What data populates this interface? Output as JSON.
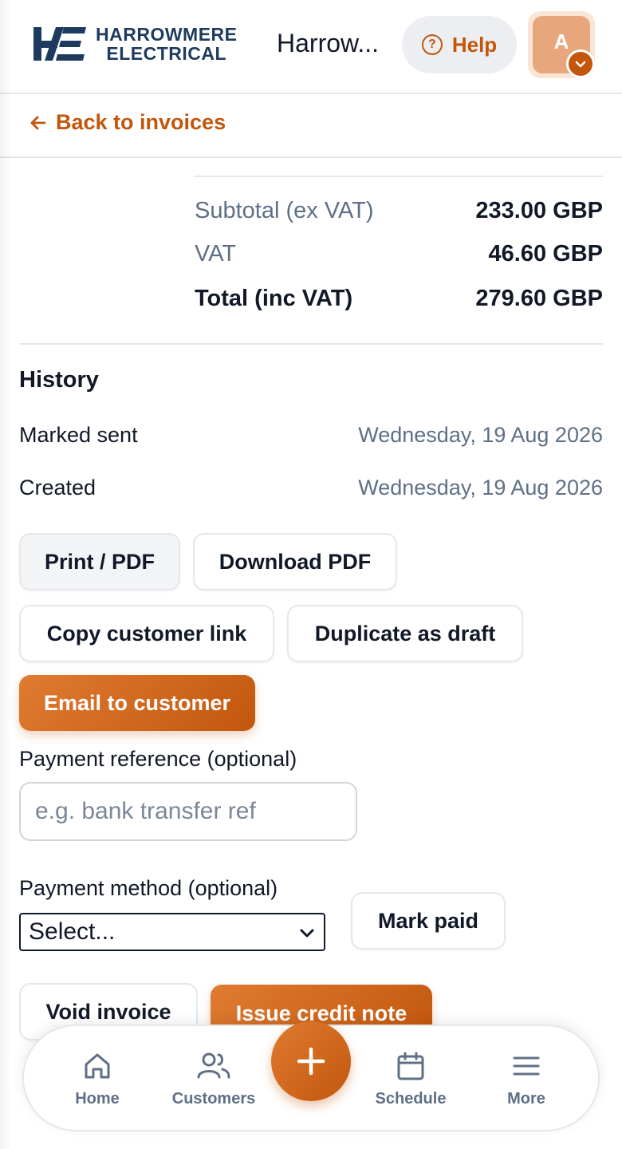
{
  "header": {
    "logo_line1": "HARROWMERE",
    "logo_line2": "ELECTRICAL",
    "brand_truncated": "Harrow...",
    "help_label": "Help",
    "avatar_initial": "A"
  },
  "nav_back": {
    "label": "Back to invoices"
  },
  "totals": {
    "subtotal_label": "Subtotal (ex VAT)",
    "subtotal_value": "233.00 GBP",
    "vat_label": "VAT",
    "vat_value": "46.60 GBP",
    "total_label": "Total (inc VAT)",
    "total_value": "279.60 GBP"
  },
  "history": {
    "title": "History",
    "rows": [
      {
        "label": "Marked sent",
        "date": "Wednesday, 19 Aug 2026"
      },
      {
        "label": "Created",
        "date": "Wednesday, 19 Aug 2026"
      }
    ]
  },
  "actions": {
    "print_pdf": "Print / PDF",
    "download_pdf": "Download PDF",
    "copy_link": "Copy customer link",
    "duplicate": "Duplicate as draft",
    "email": "Email to customer",
    "mark_paid": "Mark paid",
    "void": "Void invoice",
    "credit_note": "Issue credit note"
  },
  "payment": {
    "reference_label": "Payment reference (optional)",
    "reference_placeholder": "e.g. bank transfer ref",
    "method_label": "Payment method (optional)",
    "method_selected": "Select..."
  },
  "bottom_nav": {
    "home": "Home",
    "customers": "Customers",
    "schedule": "Schedule",
    "more": "More"
  },
  "colors": {
    "accent": "#c2570c",
    "navy": "#1e3a5f",
    "muted": "#5f6f86"
  }
}
